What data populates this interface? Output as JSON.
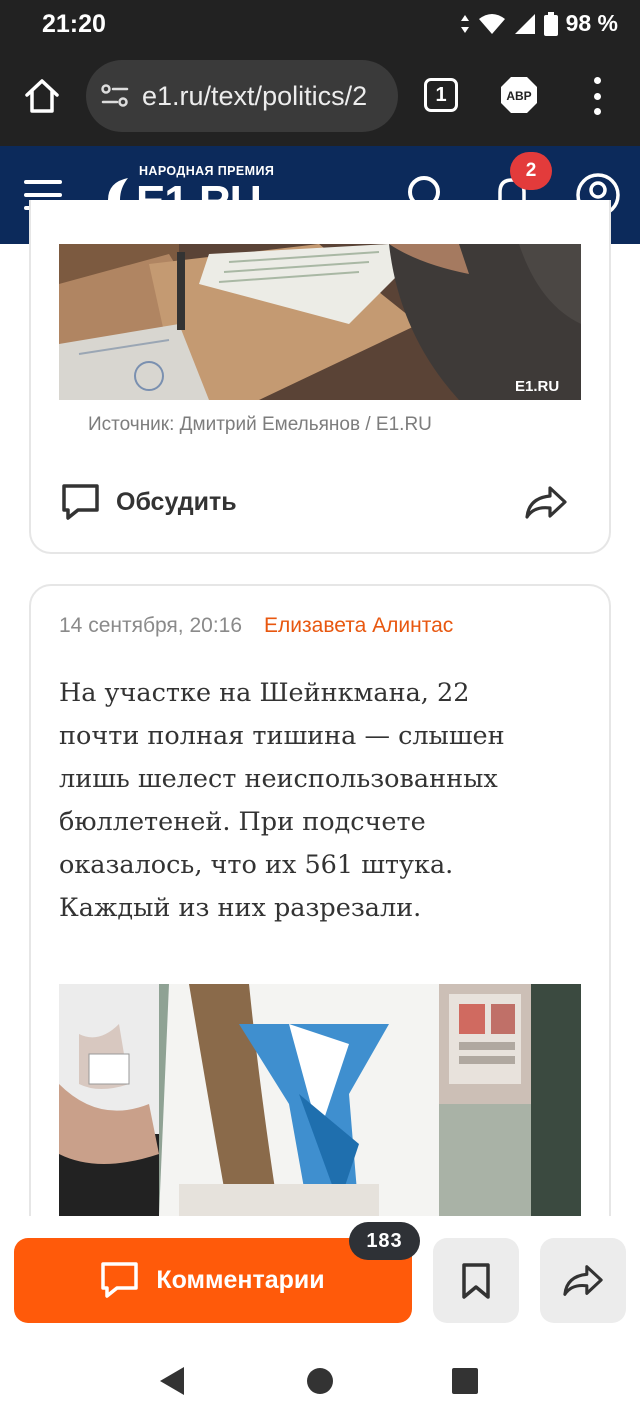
{
  "status_bar": {
    "time": "21:20",
    "battery": "98 %"
  },
  "browser": {
    "url": "e1.ru/text/politics/2",
    "tab_count": "1",
    "adblock_label": "ABP"
  },
  "site_header": {
    "logo_prize": "НАРОДНАЯ ПРЕМИЯ",
    "logo_text": "E1.RU",
    "notifications_count": "2"
  },
  "post1": {
    "watermark": "E1.RU",
    "source": "Источник: Дмитрий Емельянов / E1.RU",
    "discuss_label": "Обсудить"
  },
  "post2": {
    "date": "14 сентября, 20:16",
    "author": "Елизавета Алинтас",
    "text_lines": [
      "На участке на Шейнкмана, 22",
      "почти полная тишина — слышен",
      "лишь шелест неиспользованных",
      "бюллетеней. При подсчете",
      "оказалось, что их 561 штука.",
      "Каждый из них разрезали."
    ]
  },
  "actions": {
    "comments_label": "Комментарии",
    "comments_count": "183"
  },
  "colors": {
    "header_bg": "#0c2a5b",
    "accent_orange": "#ff5a0a",
    "badge_red": "#e33b3b"
  }
}
